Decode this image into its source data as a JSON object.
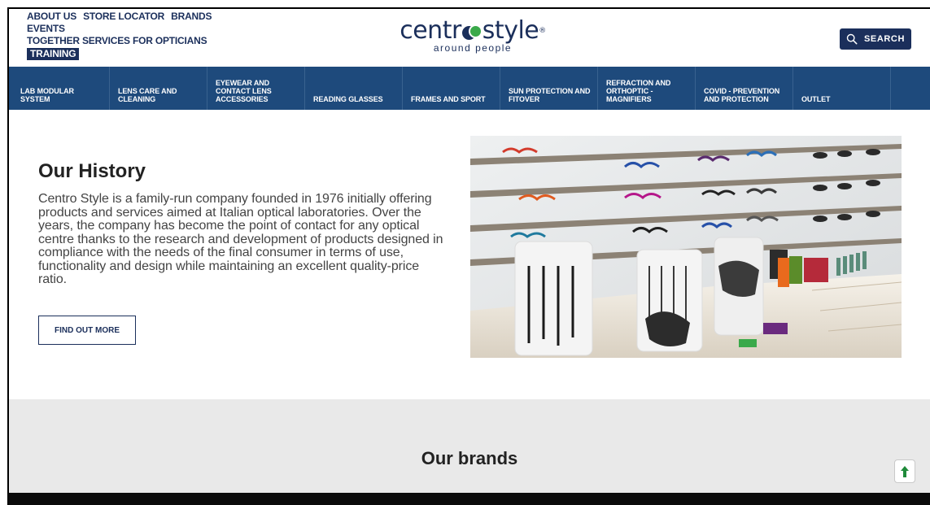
{
  "header": {
    "top_links_row1": [
      "ABOUT US",
      "STORE LOCATOR",
      "BRANDS"
    ],
    "top_links_row2": [
      "EVENTS"
    ],
    "top_links_row3": [
      "TOGETHER SERVICES FOR OPTICIANS"
    ],
    "training_label": "TRAINING",
    "logo_main_left": "centr",
    "logo_main_right": "style",
    "logo_reg": "®",
    "logo_sub": "around people",
    "search_label": "SEARCH",
    "search_icon": "search-icon"
  },
  "nav": {
    "items": [
      "LAB MODULAR SYSTEM",
      "LENS CARE AND CLEANING",
      "EYEWEAR AND CONTACT LENS ACCESSORIES",
      "READING GLASSES",
      "FRAMES AND SPORT",
      "SUN PROTECTION AND FITOVER",
      "REFRACTION AND ORTHOPTIC - MAGNIFIERS",
      "COVID - PREVENTION AND PROTECTION",
      "OUTLET"
    ]
  },
  "hero": {
    "title": "Our History",
    "text": "Centro Style is a family-run company founded in 1976 initially offering products and services aimed at Italian optical laboratories. Over the years, the company has become the point of contact for any optical centre thanks to the research and development of products designed in compliance with the needs of the final consumer in terms of use, functionality and design while maintaining an excellent quality-price ratio.",
    "button_label": "FIND OUT MORE"
  },
  "brands": {
    "title": "Our brands"
  },
  "colors": {
    "brand_navy": "#1b2f5b",
    "nav_blue": "#1e4a7c",
    "logo_green": "#3aa94a"
  }
}
